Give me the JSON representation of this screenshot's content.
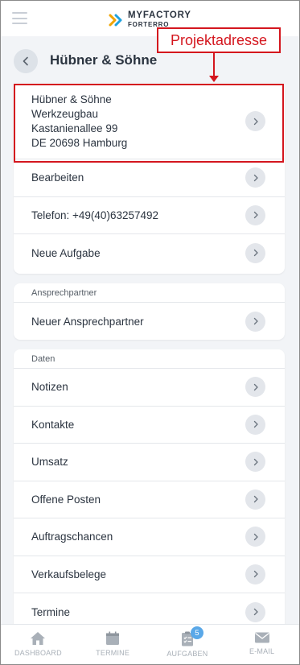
{
  "app": {
    "logo_line1": "MYFACTORY",
    "logo_line2": "FORTERRO"
  },
  "header": {
    "title": "Hübner & Söhne"
  },
  "annotation": {
    "label": "Projektadresse",
    "color": "#d4161e"
  },
  "address": {
    "line1": "Hübner & Söhne",
    "line2": "Werkzeugbau",
    "line3": "Kastanienallee 99",
    "line4": "DE 20698 Hamburg"
  },
  "actions": [
    {
      "label": "Bearbeiten"
    },
    {
      "label": "Telefon: +49(40)63257492"
    },
    {
      "label": "Neue Aufgabe"
    }
  ],
  "contacts_section": {
    "title": "Ansprechpartner",
    "items": [
      {
        "label": "Neuer Ansprechpartner"
      }
    ]
  },
  "data_section": {
    "title": "Daten",
    "items": [
      {
        "label": "Notizen"
      },
      {
        "label": "Kontakte"
      },
      {
        "label": "Umsatz"
      },
      {
        "label": "Offene Posten"
      },
      {
        "label": "Auftragschancen"
      },
      {
        "label": "Verkaufsbelege"
      },
      {
        "label": "Termine"
      }
    ]
  },
  "bottom_nav": [
    {
      "label": "DASHBOARD",
      "icon": "home-icon"
    },
    {
      "label": "TERMINE",
      "icon": "calendar-icon"
    },
    {
      "label": "AUFGABEN",
      "icon": "clipboard-icon",
      "badge": "5"
    },
    {
      "label": "E-MAIL",
      "icon": "mail-icon"
    }
  ]
}
